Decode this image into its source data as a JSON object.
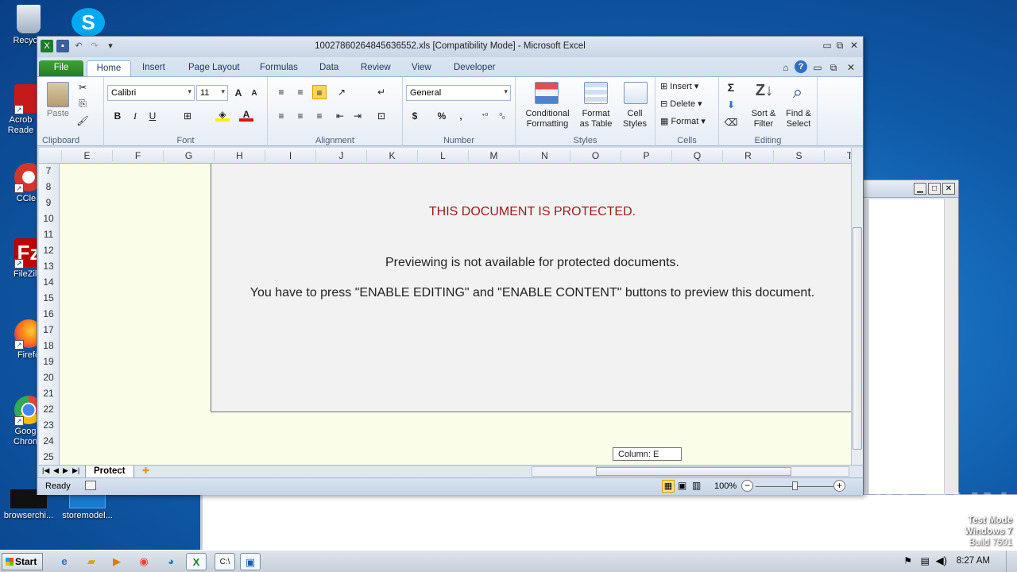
{
  "desktop": {
    "icons": [
      {
        "label": "Recycle",
        "icon": "recycle-bin-icon"
      },
      {
        "label": "Acrob Reade",
        "icon": "acrobat-icon"
      },
      {
        "label": "CClea",
        "icon": "ccleaner-icon"
      },
      {
        "label": "FileZilla",
        "icon": "filezilla-icon"
      },
      {
        "label": "Firefo",
        "icon": "firefox-icon"
      },
      {
        "label": "Goog Chron",
        "icon": "chrome-icon"
      },
      {
        "label": "browserchi...",
        "icon": "file-icon"
      },
      {
        "label": "storemodel...",
        "icon": "file-icon"
      }
    ],
    "test_mode": {
      "line1": "Test Mode",
      "line2": "Windows 7",
      "line3": "Build 7601"
    },
    "watermark": "ANY RUN"
  },
  "excel": {
    "title": "10027860264845636552.xls  [Compatibility Mode]  -  Microsoft Excel",
    "tabs": [
      "File",
      "Home",
      "Insert",
      "Page Layout",
      "Formulas",
      "Data",
      "Review",
      "View",
      "Developer"
    ],
    "ribbon": {
      "clipboard": {
        "paste": "Paste",
        "group": "Clipboard"
      },
      "font": {
        "name": "Calibri",
        "size": "11",
        "group": "Font",
        "bold": "B",
        "italic": "I",
        "underline": "U"
      },
      "alignment": {
        "group": "Alignment"
      },
      "number": {
        "format": "General",
        "group": "Number",
        "currency": "$",
        "percent": "%",
        "comma": ","
      },
      "styles": {
        "conditional": "Conditional Formatting",
        "format_table": "Format as Table",
        "cell_styles": "Cell Styles",
        "group": "Styles"
      },
      "cells": {
        "insert": "Insert",
        "delete": "Delete",
        "format": "Format",
        "group": "Cells"
      },
      "editing": {
        "sort": "Sort & Filter",
        "find": "Find & Select",
        "group": "Editing",
        "sigma": "Σ"
      }
    },
    "columns": [
      "E",
      "F",
      "G",
      "H",
      "I",
      "J",
      "K",
      "L",
      "M",
      "N",
      "O",
      "P",
      "Q",
      "R",
      "S",
      "T"
    ],
    "rows": [
      "7",
      "8",
      "9",
      "10",
      "11",
      "12",
      "13",
      "14",
      "15",
      "16",
      "17",
      "18",
      "19",
      "20",
      "21",
      "22",
      "23",
      "24",
      "25"
    ],
    "content": {
      "protected": "THIS DOCUMENT IS PROTECTED.",
      "preview": "Previewing is not available for protected documents.",
      "instruction": "You have to press \"ENABLE EDITING\" and \"ENABLE CONTENT\" buttons to preview this document."
    },
    "tooltip": "Column: E",
    "sheet_tab": "Protect",
    "status": {
      "ready": "Ready",
      "zoom": "100%"
    }
  },
  "taskbar": {
    "start": "Start",
    "clock": "8:27 AM"
  }
}
